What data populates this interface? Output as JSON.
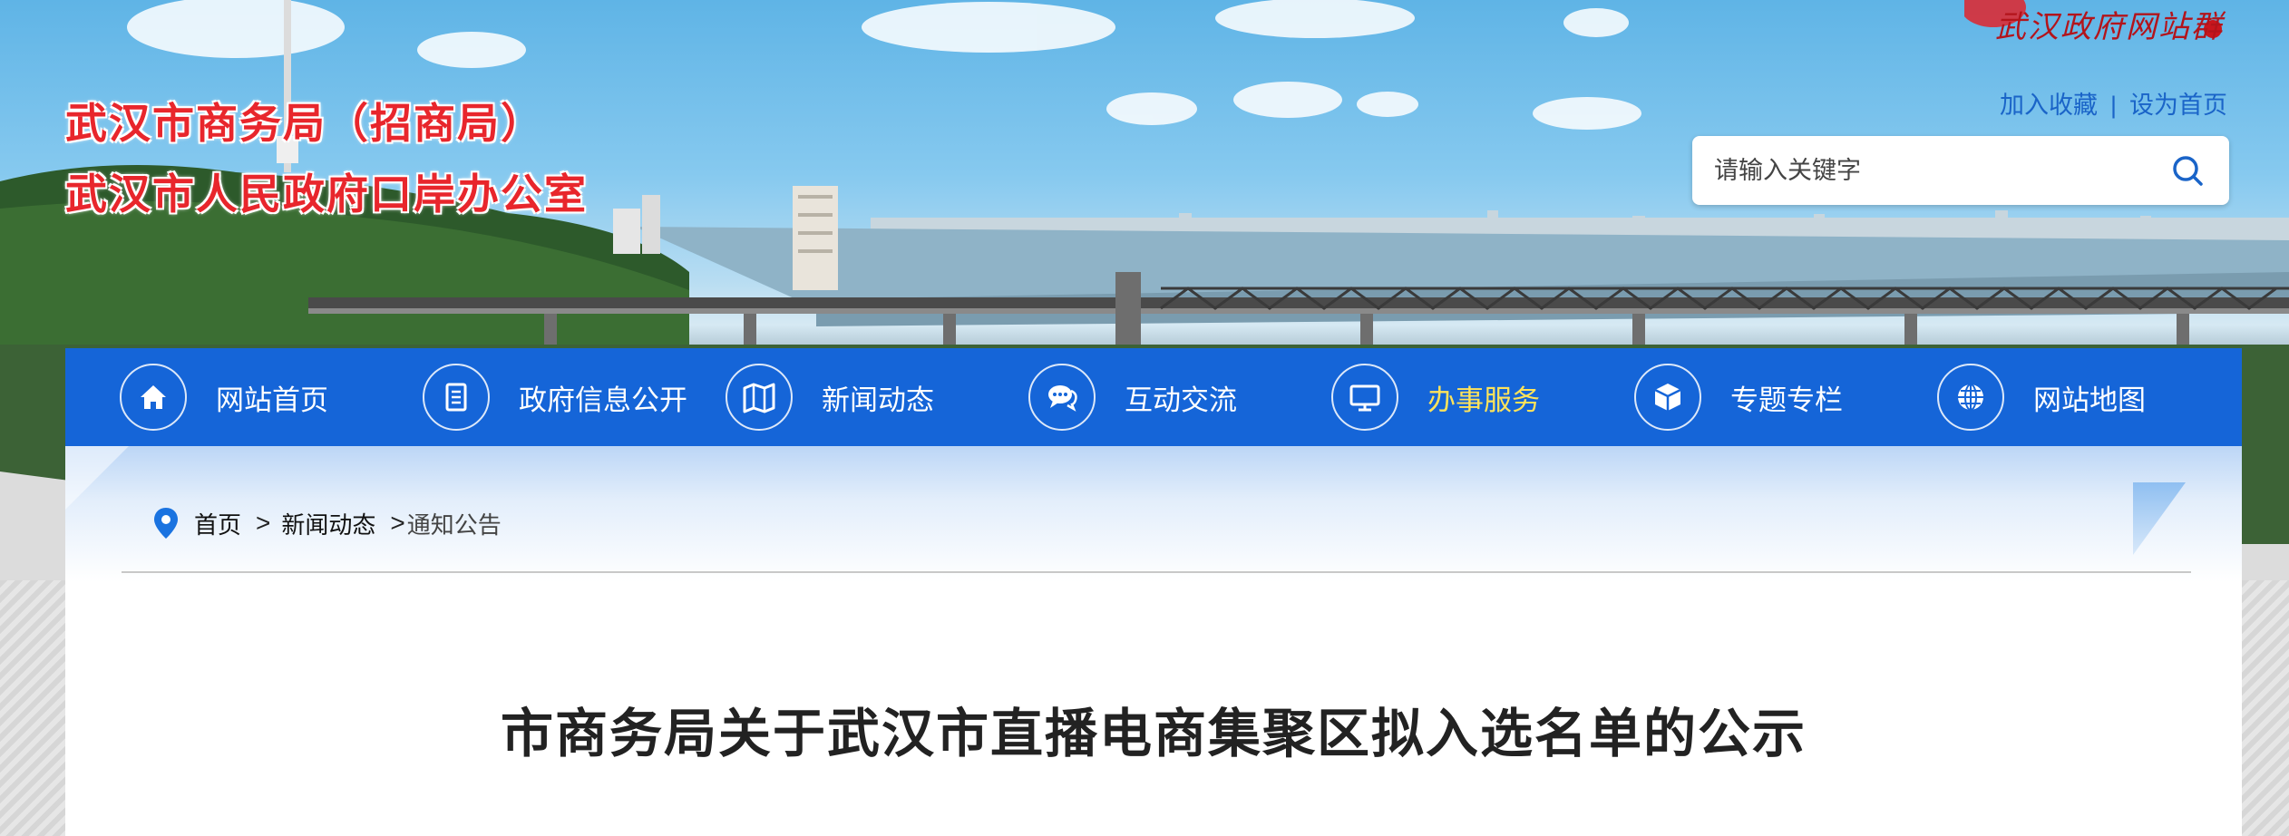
{
  "header": {
    "title_line1": "武汉市商务局（招商局）",
    "title_line2": "武汉市人民政府口岸办公室",
    "seal_text": "武汉政府网站群"
  },
  "top_links": {
    "bookmark": "加入收藏",
    "separator": "|",
    "homepage": "设为首页"
  },
  "search": {
    "placeholder": "请输入关键字"
  },
  "nav": {
    "items": [
      {
        "label": "网站首页",
        "icon": "home-icon"
      },
      {
        "label": "政府信息公开",
        "icon": "document-icon"
      },
      {
        "label": "新闻动态",
        "icon": "map-icon"
      },
      {
        "label": "互动交流",
        "icon": "chat-icon"
      },
      {
        "label": "办事服务",
        "icon": "monitor-icon",
        "active": true
      },
      {
        "label": "专题专栏",
        "icon": "cube-icon"
      },
      {
        "label": "网站地图",
        "icon": "globe-icon"
      }
    ]
  },
  "breadcrumb": {
    "home": "首页",
    "sep1": ">",
    "news": "新闻动态",
    "sep2": ">",
    "current": "通知公告"
  },
  "article": {
    "title": "市商务局关于武汉市直播电商集聚区拟入选名单的公示"
  },
  "colors": {
    "nav_bg": "#1565d8",
    "active_nav": "#ffe35a",
    "title_red": "#e8262c",
    "link_blue": "#1a64c8"
  }
}
